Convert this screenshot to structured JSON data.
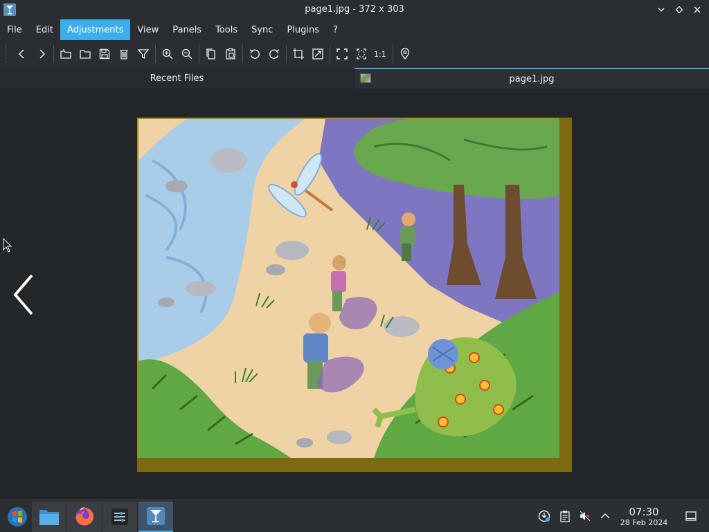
{
  "window": {
    "title": "page1.jpg - 372 x 303",
    "app_icon": "cocktail-glass-icon"
  },
  "menu": {
    "items": [
      {
        "label": "File"
      },
      {
        "label": "Edit"
      },
      {
        "label": "Adjustments",
        "active": true
      },
      {
        "label": "View"
      },
      {
        "label": "Panels"
      },
      {
        "label": "Tools"
      },
      {
        "label": "Sync"
      },
      {
        "label": "Plugins"
      },
      {
        "label": "?"
      }
    ]
  },
  "toolbar": {
    "icons": [
      "previous-icon",
      "next-icon",
      "open-recent-icon",
      "open-icon",
      "save-icon",
      "delete-icon",
      "filter-icon",
      "zoom-in-icon",
      "zoom-out-icon",
      "copy-icon",
      "paste-icon",
      "rotate-left-icon",
      "rotate-right-icon",
      "crop-icon",
      "resize-icon",
      "fullscreen-icon",
      "fit-icon",
      "original-size-icon",
      "location-icon"
    ]
  },
  "tabs": [
    {
      "label": "Recent Files"
    },
    {
      "label": "page1.jpg"
    }
  ],
  "taskbar": {
    "apps": [
      "start-menu-icon",
      "file-manager-icon",
      "firefox-icon",
      "system-settings-icon",
      "nomacs-icon"
    ],
    "tray": [
      "network-icon",
      "clipboard-icon",
      "volume-muted-icon",
      "tray-expand-icon"
    ],
    "clock": {
      "time": "07:30",
      "date": "28 Feb 2024"
    }
  },
  "colors": {
    "accent": "#3daee9",
    "background": "#232629",
    "panel": "#2a2e32"
  }
}
